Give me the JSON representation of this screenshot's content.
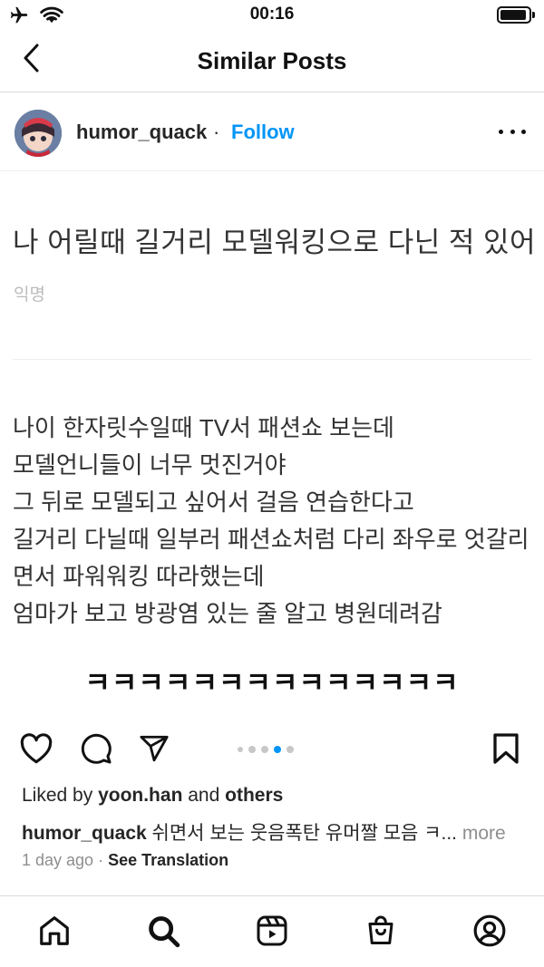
{
  "status_bar": {
    "time": "00:16"
  },
  "nav": {
    "title": "Similar Posts"
  },
  "post": {
    "username": "humor_quack",
    "separator": "·",
    "follow_label": "Follow",
    "image": {
      "heading": "나 어릴때 길거리 모델워킹으로 다닌 적 있어",
      "author": "익명",
      "body_lines": [
        "나이 한자릿수일때 TV서 패션쇼 보는데",
        "모델언니들이 너무 멋진거야",
        "그 뒤로 모델되고 싶어서 걸음 연습한다고",
        "길거리 다닐때 일부러 패션쇼처럼 다리 좌우로 엇갈리",
        "면서 파워워킹 따라했는데",
        "엄마가 보고 방광염 있는 줄 알고 병원데려감"
      ],
      "laugh": "ㅋㅋㅋㅋㅋㅋㅋㅋㅋㅋㅋㅋㅋㅋ"
    },
    "carousel": {
      "count": 5,
      "active_index": 3
    },
    "likes": {
      "prefix": "Liked by",
      "user": "yoon.han",
      "conj": "and",
      "others": "others"
    },
    "caption": {
      "user": "humor_quack",
      "text": "쉬면서 보는 웃음폭탄 유머짤 모음 ㅋ...",
      "more_label": "more"
    },
    "time_ago": "1 day ago",
    "meta_separator": "·",
    "see_translation": "See Translation"
  },
  "icons": {
    "status": [
      "airplane-icon",
      "wifi-icon",
      "battery-icon"
    ],
    "nav": [
      "back-chevron-icon"
    ],
    "actions": [
      "heart-icon",
      "comment-icon",
      "share-icon",
      "bookmark-icon"
    ],
    "tabs": [
      "home-icon",
      "search-icon",
      "reels-icon",
      "shop-icon",
      "profile-icon"
    ]
  },
  "colors": {
    "accent": "#0095f6",
    "muted": "#8e8e8e",
    "text": "#262626"
  }
}
